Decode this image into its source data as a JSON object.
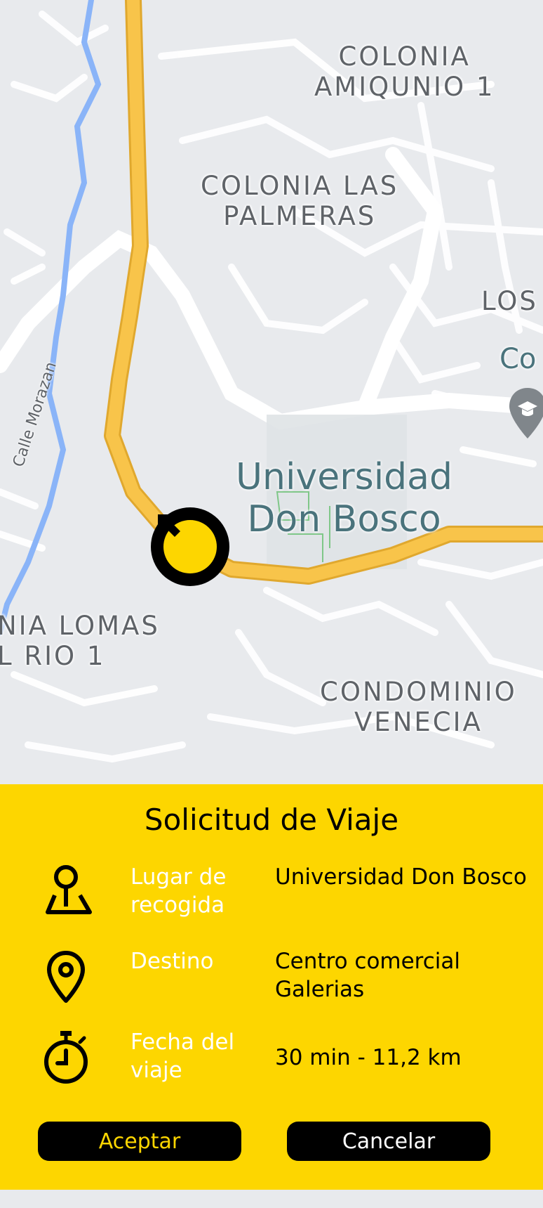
{
  "map": {
    "area_labels": [
      {
        "id": "colonia-amiqunio",
        "text": "COLONIA\nAMIQUNIO 1"
      },
      {
        "id": "colonia-las-palmeras",
        "text": "COLONIA LAS\nPALMERAS"
      },
      {
        "id": "los",
        "text": "LOS"
      },
      {
        "id": "lomas-del-rio",
        "text": "NIA LOMAS\nL RIO 1"
      },
      {
        "id": "condominio-venecia",
        "text": "CONDOMINIO\nVENECIA"
      }
    ],
    "poi_label": "Universidad\nDon Bosco",
    "poi_partial": "Co",
    "street_label": "Calle Morazan",
    "icons": {
      "marker": "navigation-arrow-icon",
      "poi": "school-pin-icon"
    }
  },
  "request": {
    "title": "Solicitud de Viaje",
    "rows": [
      {
        "icon": "pickup-location-icon",
        "label": "Lugar de recogida",
        "value": "Universidad Don Bosco"
      },
      {
        "icon": "map-pin-icon",
        "label": "Destino",
        "value": "Centro comercial Galerias"
      },
      {
        "icon": "stopwatch-icon",
        "label": "Fecha del viaje",
        "value": "30 min - 11,2 km"
      }
    ],
    "accept_label": "Aceptar",
    "cancel_label": "Cancelar"
  },
  "colors": {
    "accent": "#fdd600",
    "dark": "#000000",
    "label_text": "#ffffff",
    "map_background": "#e8eaed",
    "highway": "#f8c44a",
    "river": "#8ab4f8"
  }
}
